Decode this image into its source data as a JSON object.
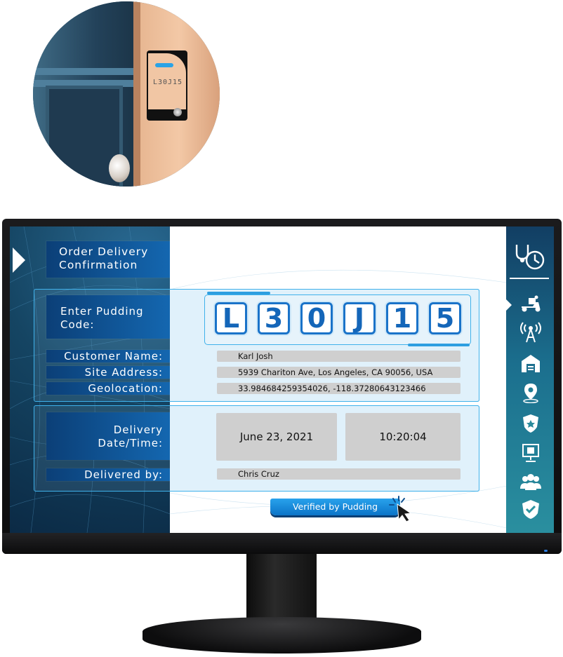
{
  "device_photo": {
    "code_text": "L30J15"
  },
  "screen": {
    "title": "Order Delivery Confirmation",
    "code_label": "Enter Pudding Code:",
    "code_chars": [
      "L",
      "3",
      "0",
      "J",
      "1",
      "5"
    ],
    "fields": {
      "customer_label": "Customer Name:",
      "customer_value": "Karl Josh",
      "address_label": "Site Address:",
      "address_value": "5939 Chariton Ave, Los Angeles, CA 90056, USA",
      "geo_label": "Geolocation:",
      "geo_value": "33.984684259354026, -118.37280643123466",
      "datetime_label": "Delivery Date/Time:",
      "date_value": "June 23, 2021",
      "time_value": "10:20:04",
      "delivered_by_label": "Delivered by:",
      "delivered_by_value": "Chris Cruz"
    },
    "verify_button": "Verified by Pudding",
    "sidebar_icons": [
      "delivery-clock-icon",
      "delivery-scooter-icon",
      "signal-tower-icon",
      "warehouse-icon",
      "location-pin-icon",
      "police-badge-icon",
      "kiosk-screen-icon",
      "group-icon",
      "shield-check-icon"
    ]
  },
  "colors": {
    "accent": "#1a73c9",
    "label_bg": "#0b3f77",
    "field_bg": "#cfcfcf",
    "button": "#1a8fe0"
  }
}
